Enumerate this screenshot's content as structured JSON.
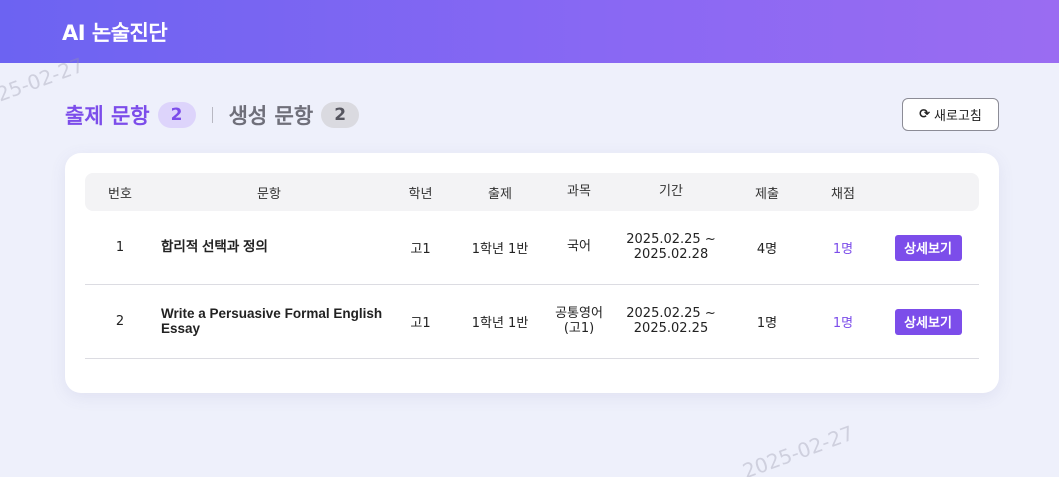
{
  "app": {
    "title": "AI 논술진단"
  },
  "watermark": {
    "text": "2025-02-27"
  },
  "tabs": [
    {
      "label": "출제 문항",
      "count": "2",
      "active": true
    },
    {
      "label": "생성 문항",
      "count": "2",
      "active": false
    }
  ],
  "toolbar": {
    "refresh_label": "새로고침",
    "refresh_icon": "refresh-icon"
  },
  "table": {
    "headers": {
      "no": "번호",
      "question": "문항",
      "grade": "학년",
      "class": "출제",
      "subject": "과목",
      "period": "기간",
      "submitted": "제출",
      "graded": "채점"
    },
    "rows": [
      {
        "no": "1",
        "question": "합리적 선택과 정의",
        "grade": "고1",
        "class": "1학년 1반",
        "subject": "국어",
        "period": "2025.02.25 ~\n2025.02.28",
        "submitted": "4명",
        "graded": "1명",
        "action": "상세보기"
      },
      {
        "no": "2",
        "question": "Write a Persuasive Formal English Essay",
        "grade": "고1",
        "class": "1학년 1반",
        "subject": "공통영어\n(고1)",
        "period": "2025.02.25 ~\n2025.02.25",
        "submitted": "1명",
        "graded": "1명",
        "action": "상세보기"
      }
    ]
  },
  "colors": {
    "accent": "#7c4dea",
    "header_start": "#6c63f2",
    "header_end": "#9a6cf2",
    "background": "#eef0fb"
  }
}
